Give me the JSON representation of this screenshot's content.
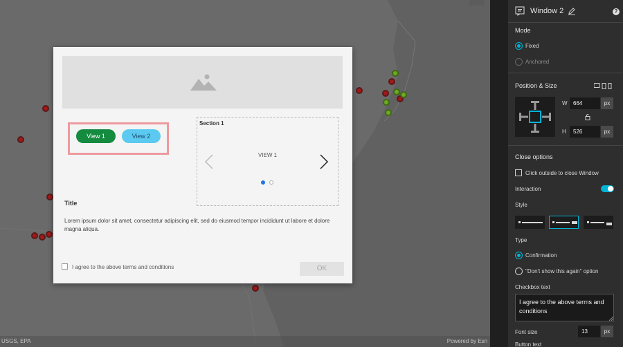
{
  "map": {
    "search_icon": "search-icon",
    "attribution_left": "USGS, EPA",
    "attribution_right": "Powered by Esri"
  },
  "modal": {
    "image_icon": "image-placeholder-icon",
    "view_buttons": [
      {
        "label": "View 1"
      },
      {
        "label": "View 2"
      }
    ],
    "section": {
      "title": "Section 1",
      "current_view": "VIEW 1",
      "prev_glyph": "〈",
      "next_glyph": "〉"
    },
    "title": "Title",
    "body": "Lorem ipsum dolor sit amet, consectetur adipiscing elit, sed do eiusmod tempor incididunt ut labore et dolore magna aliqua.",
    "agree_label": "I agree to the above terms and conditions",
    "ok_label": "OK"
  },
  "panel": {
    "title": "Window 2",
    "help_glyph": "?",
    "mode": {
      "heading": "Mode",
      "options": [
        {
          "label": "Fixed",
          "selected": true
        },
        {
          "label": "Anchored",
          "selected": false
        }
      ]
    },
    "position": {
      "heading": "Position & Size",
      "w_label": "W",
      "w_value": "664",
      "h_label": "H",
      "h_value": "526",
      "unit": "px"
    },
    "close": {
      "heading": "Close options",
      "click_outside": "Click outside to close Window",
      "interaction": "Interaction",
      "style": "Style",
      "type": "Type",
      "type_options": [
        {
          "label": "Confirmation",
          "selected": true
        },
        {
          "label": "\"Don't show this again\" option",
          "selected": false
        }
      ],
      "checkbox_text_label": "Checkbox text",
      "checkbox_text_value": "I agree to the above terms and conditions",
      "font_size_label": "Font size",
      "font_size_value": "13",
      "font_size_unit": "px",
      "button_text_label": "Button text"
    },
    "colors": {
      "accent": "#00b4d8"
    }
  }
}
